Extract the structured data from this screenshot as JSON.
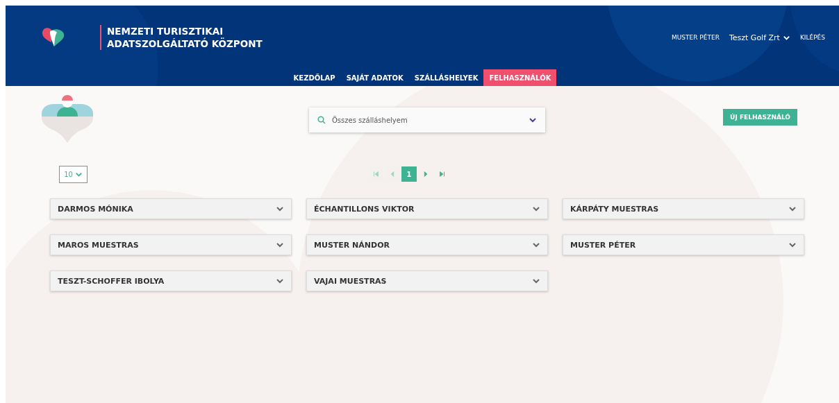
{
  "header": {
    "title_lines": [
      "NEMZETI TURISZTIKAI",
      "ADATSZOLGÁLTATÓ KÖZPONT"
    ],
    "user_name": "MUSTER PÉTER",
    "company": "Teszt Golf Zrt",
    "logout": "KILÉPÉS"
  },
  "nav": [
    {
      "label": "KEZDŐLAP",
      "selected": false
    },
    {
      "label": "SAJÁT ADATOK",
      "selected": false
    },
    {
      "label": "SZÁLLÁSHELYEK",
      "selected": false
    },
    {
      "label": "FELHASZNÁLÓK",
      "selected": true
    }
  ],
  "search": {
    "value": "Összes szálláshelyem"
  },
  "new_user_button": "ÚJ FELHASZNÁLÓ",
  "page_size": "10",
  "pagination": [
    {
      "kind": "first",
      "disabled": true
    },
    {
      "kind": "prev",
      "disabled": true
    },
    {
      "kind": "page",
      "label": "1",
      "selected": true
    },
    {
      "kind": "next",
      "disabled": false
    },
    {
      "kind": "last",
      "disabled": false
    }
  ],
  "users": [
    {
      "name": "DARMOS MÓNIKA",
      "expanded": false
    },
    {
      "name": "ÉCHANTILLONS VIKTOR",
      "expanded": false
    },
    {
      "name": "KÁRPÁTY MUESTRAS",
      "expanded": false
    },
    {
      "name": "MAROS MUESTRAS",
      "expanded": false
    },
    {
      "name": "MUSTER NÁNDOR",
      "expanded": false
    },
    {
      "name": "MUSTER PÉTER",
      "expanded": false
    },
    {
      "name": "TESZT-SCHOFFER IBOLYA",
      "expanded": false
    },
    {
      "name": "VAJAI MUESTRAS",
      "expanded": false
    }
  ]
}
